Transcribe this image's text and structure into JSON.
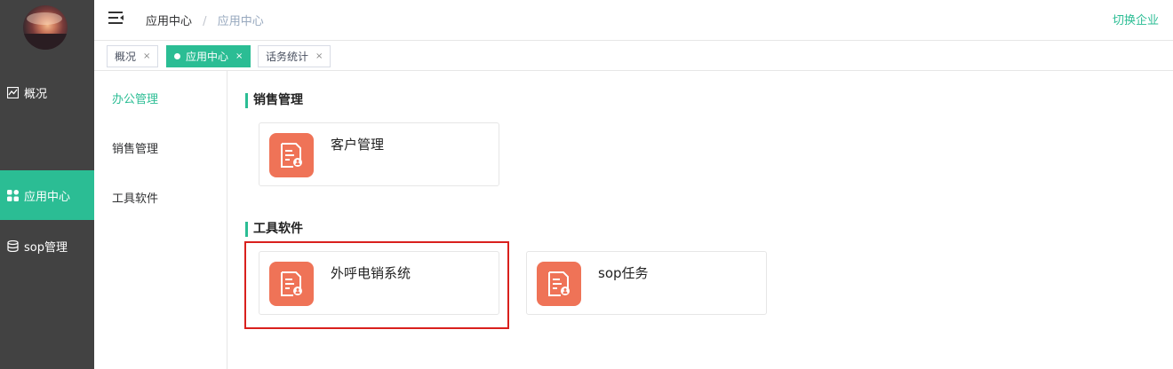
{
  "sidebar": {
    "items": [
      {
        "label": "概况",
        "icon": "chart-icon"
      },
      {
        "label": "应用中心",
        "icon": "apps-grid-icon",
        "active": true
      },
      {
        "label": "sop管理",
        "icon": "database-icon"
      }
    ]
  },
  "header": {
    "breadcrumb": [
      "应用中心",
      "应用中心"
    ],
    "switch_label": "切换企业"
  },
  "tabs": [
    {
      "label": "概况",
      "close": "×"
    },
    {
      "label": "应用中心",
      "close": "×",
      "active": true
    },
    {
      "label": "话务统计",
      "close": "×"
    }
  ],
  "subnav": {
    "items": [
      {
        "label": "办公管理",
        "active": true
      },
      {
        "label": "销售管理"
      },
      {
        "label": "工具软件"
      }
    ]
  },
  "sections": [
    {
      "title": "销售管理",
      "apps": [
        {
          "name": "客户管理",
          "icon": "document-user-icon"
        }
      ]
    },
    {
      "title": "工具软件",
      "apps": [
        {
          "name": "外呼电销系统",
          "icon": "document-user-icon"
        },
        {
          "name": "sop任务",
          "icon": "document-user-icon"
        }
      ]
    }
  ],
  "colors": {
    "accent": "#2bbd94",
    "sidebar_bg": "#424242",
    "app_icon": "#ef7357",
    "highlight": "#d9201d"
  }
}
